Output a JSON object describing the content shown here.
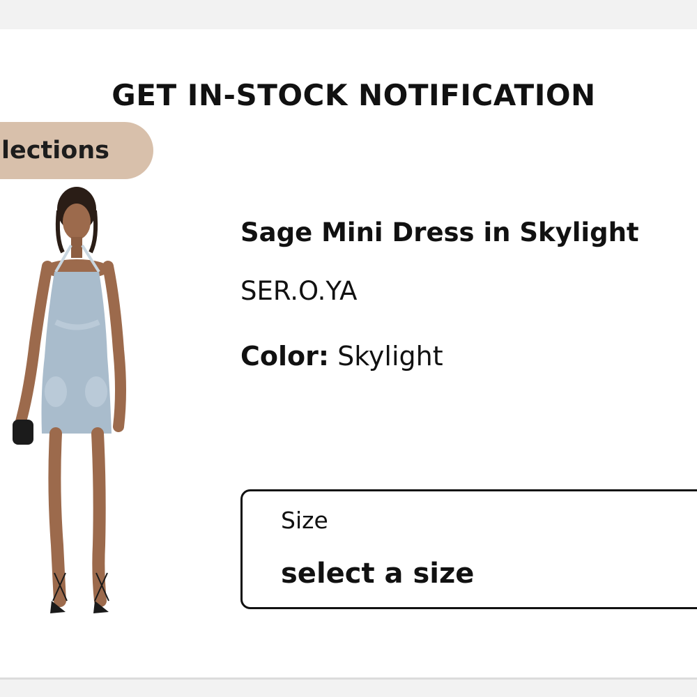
{
  "modal": {
    "title": "GET IN-STOCK NOTIFICATION"
  },
  "collections_tab": {
    "label": "llections"
  },
  "product": {
    "name": "Sage Mini Dress in Skylight",
    "brand": "SER.O.YA",
    "color_label": "Color:",
    "color_value": "Skylight",
    "image_alt": "Model wearing light-wash denim halter mini dress"
  },
  "size_select": {
    "label": "Size",
    "value": "select a size"
  },
  "colors": {
    "pill": "#d8c0ab",
    "denim": "#a9bccc",
    "text": "#111111"
  }
}
